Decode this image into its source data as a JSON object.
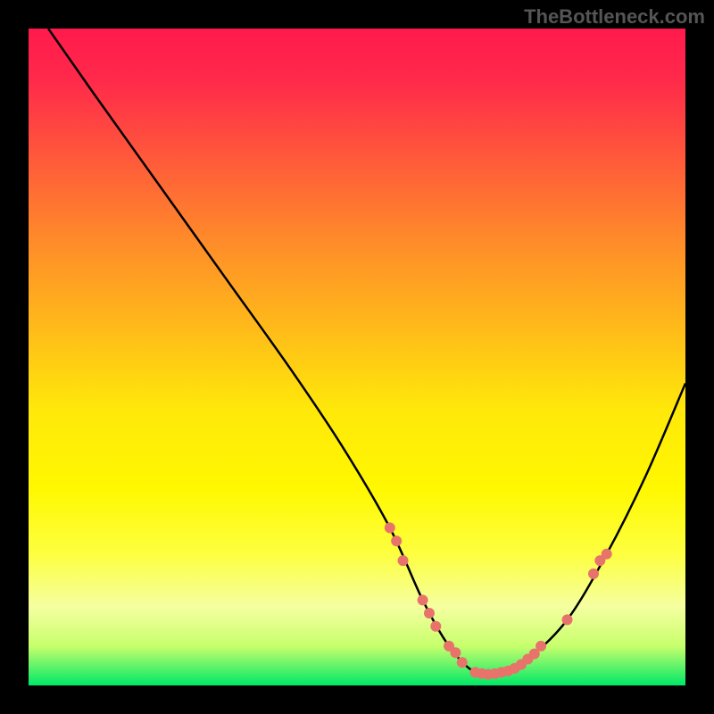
{
  "watermark": "TheBottleneck.com",
  "chart_data": {
    "type": "line",
    "title": "",
    "xlabel": "",
    "ylabel": "",
    "xlim": [
      0,
      100
    ],
    "ylim": [
      0,
      100
    ],
    "series": [
      {
        "name": "bottleneck-curve",
        "x": [
          3,
          10,
          20,
          30,
          40,
          48,
          55,
          60,
          64,
          68,
          72,
          76,
          82,
          88,
          94,
          100
        ],
        "y": [
          100,
          90,
          76,
          62,
          48,
          36,
          24,
          13,
          6,
          2,
          2,
          4,
          10,
          20,
          32,
          46
        ]
      }
    ],
    "markers": [
      {
        "x": 55,
        "y": 24
      },
      {
        "x": 56,
        "y": 22
      },
      {
        "x": 57,
        "y": 19
      },
      {
        "x": 60,
        "y": 13
      },
      {
        "x": 61,
        "y": 11
      },
      {
        "x": 62,
        "y": 9
      },
      {
        "x": 64,
        "y": 6
      },
      {
        "x": 65,
        "y": 5
      },
      {
        "x": 66,
        "y": 3.5
      },
      {
        "x": 68,
        "y": 2
      },
      {
        "x": 69,
        "y": 1.8
      },
      {
        "x": 70,
        "y": 1.7
      },
      {
        "x": 71,
        "y": 1.8
      },
      {
        "x": 72,
        "y": 2
      },
      {
        "x": 73,
        "y": 2.2
      },
      {
        "x": 74,
        "y": 2.6
      },
      {
        "x": 75,
        "y": 3.2
      },
      {
        "x": 76,
        "y": 4
      },
      {
        "x": 77,
        "y": 4.8
      },
      {
        "x": 78,
        "y": 6
      },
      {
        "x": 82,
        "y": 10
      },
      {
        "x": 86,
        "y": 17
      },
      {
        "x": 87,
        "y": 19
      },
      {
        "x": 88,
        "y": 20
      }
    ],
    "colors": {
      "curve": "#000000",
      "markers": "#e8736b",
      "gradient_top": "#ff1a4d",
      "gradient_bottom": "#00e868"
    }
  }
}
